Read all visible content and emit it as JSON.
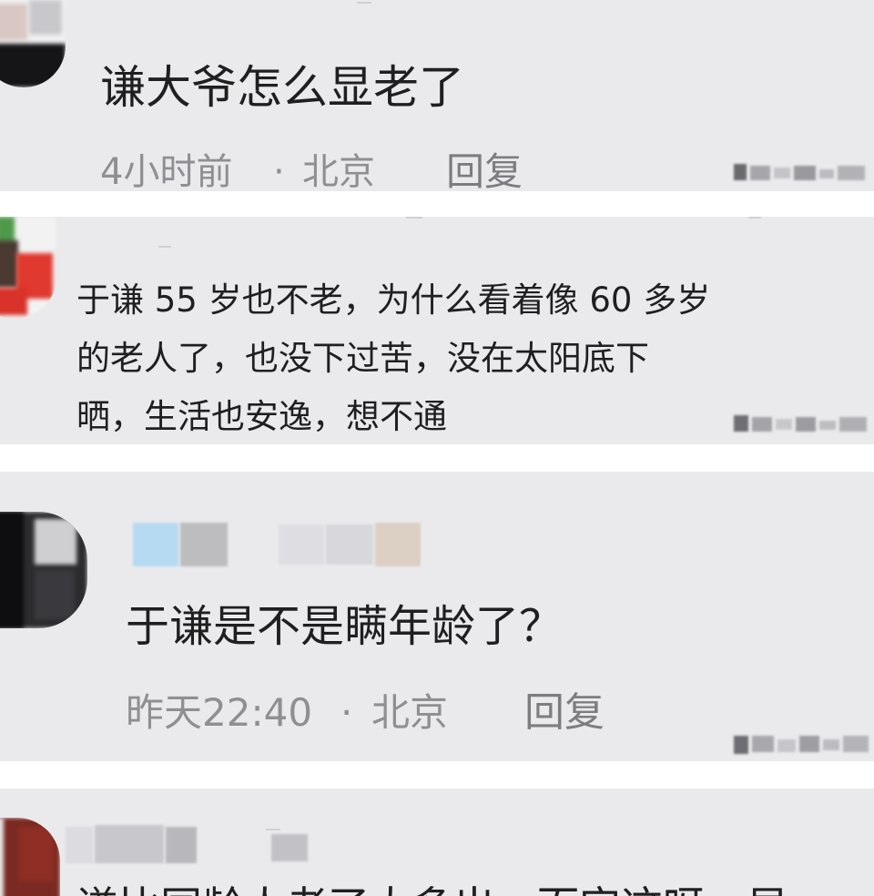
{
  "comments": [
    {
      "lines": [
        "谦大爷怎么显老了"
      ],
      "time": "4小时前",
      "location": "北京",
      "reply_label": "回复"
    },
    {
      "lines": [
        "于谦 55 岁也不老，为什么看着像 60 多岁",
        "的老人了，也没下过苦，没在太阳底下",
        "晒，生活也安逸，想不通"
      ]
    },
    {
      "lines": [
        "于谦是不是瞒年龄了？"
      ],
      "time": "昨天22:40",
      "location": "北京",
      "reply_label": "回复"
    },
    {
      "lines": [
        "谦比同龄人老了太多出一而实这呀一早"
      ]
    }
  ],
  "separator": "·",
  "colors": {
    "card_bg": "#eaeaed",
    "gap_bg": "#ffffff",
    "text": "#1f1f1f",
    "meta": "#8f8f93"
  },
  "icons": [
    "avatar-blurred",
    "username-blurred",
    "like-count-blurred"
  ]
}
